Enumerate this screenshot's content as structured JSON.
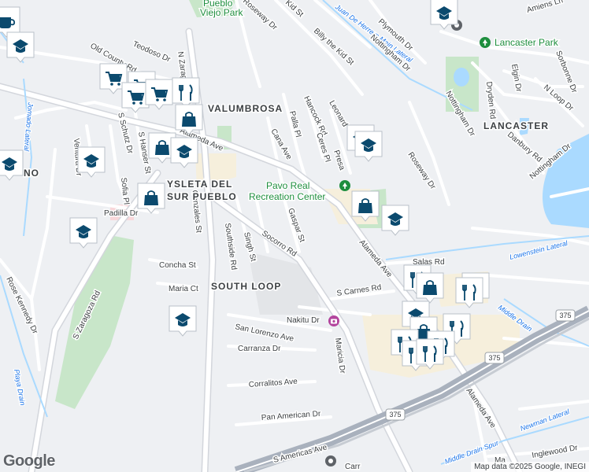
{
  "colors": {
    "background": "#eef0f3",
    "road": "#ffffff",
    "road_outline": "#d3d6dc",
    "highway": "#a9b1bd",
    "park": "#c8e6c9",
    "water": "#aadaff",
    "commercial": "#f6efdc",
    "poi_marker": "#ffffff",
    "poi_icon": "#0b4a6e"
  },
  "area_labels": [
    {
      "text": "VALUMBROSA"
    },
    {
      "text": "YSLETA DEL"
    },
    {
      "text": "SUR PUEBLO"
    },
    {
      "text": "SOUTH LOOP"
    },
    {
      "text": "LANCASTER"
    },
    {
      "text": "NO"
    }
  ],
  "park_labels": [
    {
      "text": "Pueblo"
    },
    {
      "text": "Viejo Park"
    },
    {
      "text": "Lancaster Park"
    },
    {
      "text": "Pavo Real"
    },
    {
      "text": "Recreation Center"
    }
  ],
  "street_labels": [
    "Roseway Dr",
    "Kid St",
    "Billy the Kid St",
    "Plymouth Dr",
    "Nottingham Dr",
    "Amiens Ln",
    "Teodoso Dr",
    "N Zaragoza Rd",
    "Old County Rd",
    "S Schutz Dr",
    "S Hanser St",
    "Ventura Dr",
    "Sofia Pl",
    "Padilla Dr",
    "Gonzales St",
    "Southside Rd",
    "Singh St",
    "Socorro Rd",
    "Gaspar St",
    "Cana Ave",
    "Palla Pl",
    "Hancock Rd",
    "Leonard",
    "Ceres Pl",
    "Presa",
    "Alameda Ave",
    "Roseway Dr",
    "Nottingham Dr",
    "Elgin Dr",
    "Dryden Rd",
    "Sorbonne Dr",
    "Danbury Rd",
    "N Loop Dr",
    "Nottingham Dr",
    "Concha St",
    "Maria Ct",
    "S Zaragoza Rd",
    "Rose Kennedy Dr",
    "Nakitu Dr",
    "Maricia Dr",
    "San Lorenzo Ave",
    "Carranza Dr",
    "Corralitos Ave",
    "Pan American Dr",
    "S Americas Ave",
    "S Carnes Rd",
    "Alameda Ave",
    "Alameda Ave",
    "Inglewood Dr",
    "Carr",
    "Ma",
    "Salas Rd"
  ],
  "water_labels": [
    "Juan De Herrera Main Lateral",
    "Lowenstein Lateral",
    "Middle Drain",
    "Newman Lateral",
    "Middle Drain Spur",
    "Playa Drain",
    "Jomado Lateral"
  ],
  "highway_shields": [
    "375",
    "375",
    "375"
  ],
  "poi_markers": [
    {
      "icon": "school-icon"
    },
    {
      "icon": "cafe-icon"
    },
    {
      "icon": "school-icon"
    },
    {
      "icon": "shopping-cart-icon"
    },
    {
      "icon": "shopping-cart-icon"
    },
    {
      "icon": "shopping-cart-icon"
    },
    {
      "icon": "restaurant-icon"
    },
    {
      "icon": "shopping-bag-icon"
    },
    {
      "icon": "shopping-bag-icon"
    },
    {
      "icon": "school-icon"
    },
    {
      "icon": "school-icon"
    },
    {
      "icon": "school-icon"
    },
    {
      "icon": "school-icon"
    },
    {
      "icon": "school-icon"
    },
    {
      "icon": "shopping-bag-icon"
    },
    {
      "icon": "school-icon"
    },
    {
      "icon": "school-icon"
    },
    {
      "icon": "shopping-bag-icon"
    },
    {
      "icon": "restaurant-icon"
    },
    {
      "icon": "restaurant-icon"
    },
    {
      "icon": "restaurant-icon"
    },
    {
      "icon": "restaurant-icon"
    },
    {
      "icon": "shopping-bag-icon"
    },
    {
      "icon": "restaurant-icon"
    },
    {
      "icon": "restaurant-icon"
    },
    {
      "icon": "school-icon"
    },
    {
      "icon": "school-icon"
    },
    {
      "icon": "camera-icon"
    },
    {
      "icon": "park-icon"
    },
    {
      "icon": "recreation-icon"
    }
  ],
  "attribution": "Map data ©2025 Google, INEGI",
  "logo": "Google"
}
